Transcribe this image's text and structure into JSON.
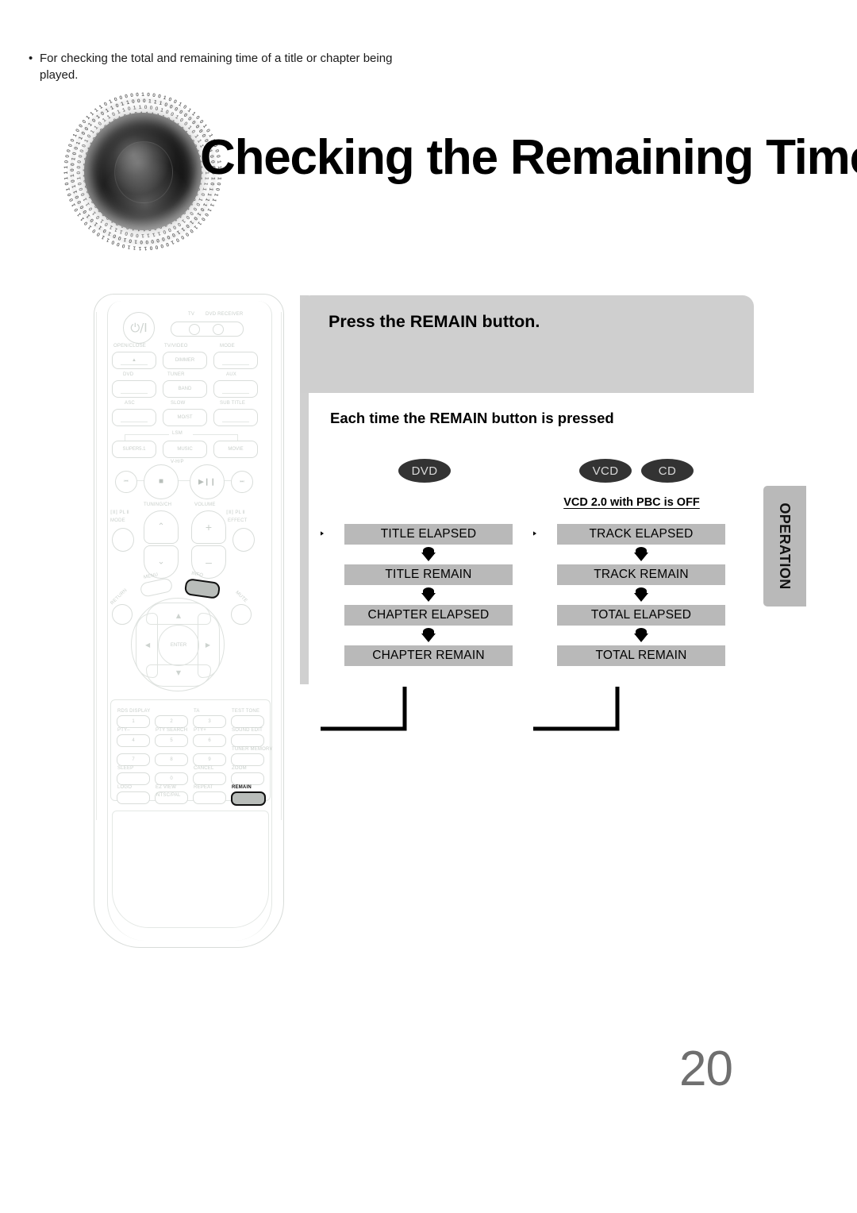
{
  "header": {
    "title": "Checking the Remaining Time",
    "logo_icon": "speaker-disc-binary-logo"
  },
  "panel": {
    "heading": "Press the REMAIN button.",
    "bullet_marker": "•",
    "bullet_text": "For checking the total and remaining time of a title or chapter being played."
  },
  "subheading": "Each time the REMAIN button is pressed",
  "flows": {
    "dvd": {
      "badges": [
        "DVD"
      ],
      "note": "",
      "steps": [
        "TITLE ELAPSED",
        "TITLE REMAIN",
        "CHAPTER ELAPSED",
        "CHAPTER REMAIN"
      ]
    },
    "vcd_cd": {
      "badges": [
        "VCD",
        "CD"
      ],
      "note": "VCD 2.0 with PBC is OFF",
      "steps": [
        "TRACK ELAPSED",
        "TRACK REMAIN",
        "TOTAL ELAPSED",
        "TOTAL REMAIN"
      ]
    }
  },
  "side_tab": {
    "label": "OPERATION"
  },
  "page_number": "20",
  "remote": {
    "power_glyph": "⏻/I",
    "selector": {
      "left_label": "TV",
      "right_label": "DVD RECEIVER"
    },
    "row_openclose": [
      "OPEN/CLOSE",
      "TV/VIDEO",
      "MODE"
    ],
    "row_openclose_sub": [
      "▲",
      "DIMMER",
      ""
    ],
    "row_source": [
      "DVD",
      "TUNER",
      "AUX"
    ],
    "row_source_sub": [
      "",
      "BAND",
      ""
    ],
    "row_asc": [
      "ASC",
      "SLOW",
      "SUB TITLE"
    ],
    "row_asc_sub": [
      "",
      "MO/ST",
      ""
    ],
    "lsm_label": "LSM",
    "row_lsm": [
      "SUPER5.1",
      "MUSIC",
      "MOVIE"
    ],
    "vhp_label": "V-H/P",
    "transport": [
      "⏮",
      "■",
      "▶❙❙",
      "⏭"
    ],
    "tuning_label": "TUNING/CH",
    "volume_label": "VOLUME",
    "plii_mode": [
      "⟦Ⅱ⟧ PL Ⅱ",
      "MODE"
    ],
    "plii_effect": [
      "⟦Ⅱ⟧ PL Ⅱ",
      "EFFECT"
    ],
    "menu_label": "MENU",
    "info_label": "INFO",
    "return_label": "RETURN",
    "mute_label": "MUTE",
    "enter_label": "ENTER",
    "keypad": [
      {
        "top": "RDS DISPLAY",
        "key": "1"
      },
      {
        "top": "",
        "key": "2"
      },
      {
        "top": "TA",
        "key": "3"
      },
      {
        "top": "TEST TONE",
        "key": ""
      },
      {
        "top": "PTY–",
        "key": "4"
      },
      {
        "top": "PTY SEARCH",
        "key": "5"
      },
      {
        "top": "PTY+",
        "key": "6"
      },
      {
        "top": "SOUND EDIT",
        "key": ""
      },
      {
        "top": "",
        "key": "7"
      },
      {
        "top": "",
        "key": "8"
      },
      {
        "top": "",
        "key": "9"
      },
      {
        "top": "TUNER MEMORY",
        "key": ""
      },
      {
        "top": "SLEEP",
        "key": ""
      },
      {
        "top": "",
        "key": "0"
      },
      {
        "top": "CANCEL",
        "key": ""
      },
      {
        "top": "ZOOM",
        "key": ""
      },
      {
        "top": "LOGO",
        "key": ""
      },
      {
        "top": "EZ VIEW",
        "key": ""
      },
      {
        "top": "REPEAT",
        "key": ""
      },
      {
        "top": "REMAIN",
        "key": ""
      }
    ],
    "ntscpal_label": "NTSC/PAL",
    "highlighted_buttons": [
      "INFO",
      "REMAIN"
    ]
  },
  "colors": {
    "panel_gray": "#cfcfcf",
    "step_gray": "#b9b9b9",
    "badge_dark": "#333333",
    "page_number_gray": "#6f6f6f",
    "rail_gray": "#d0d0d0"
  }
}
